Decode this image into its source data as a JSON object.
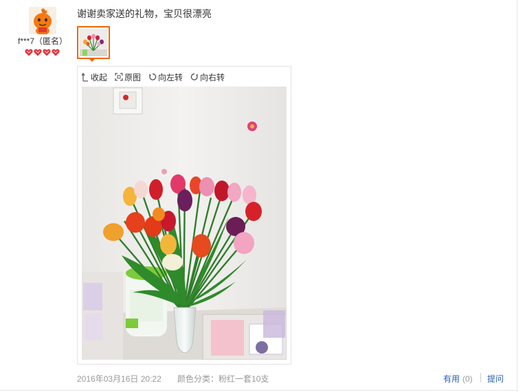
{
  "user": {
    "name": "f***7（匿名）",
    "rating_hearts": 4,
    "avatar_icon": "orange-mascot-avatar"
  },
  "review": {
    "text": "谢谢卖家送的礼物，宝贝很漂亮"
  },
  "viewer": {
    "toolbar": {
      "collapse": "收起",
      "original": "原图",
      "rotate_left": "向左转",
      "rotate_right": "向右转"
    },
    "photo_icon": "tulip-bouquet-photo"
  },
  "footer": {
    "date": "2016年03月16日 20:22",
    "color_label": "颜色分类：",
    "color_value": "粉红一套10支",
    "useful_label": "有用",
    "useful_count": "(0)",
    "ask_label": "提问"
  },
  "colors": {
    "accent_orange": "#f26700",
    "link_blue": "#2a5db0",
    "muted_gray": "#999999",
    "heart_red": "#e5343b"
  }
}
